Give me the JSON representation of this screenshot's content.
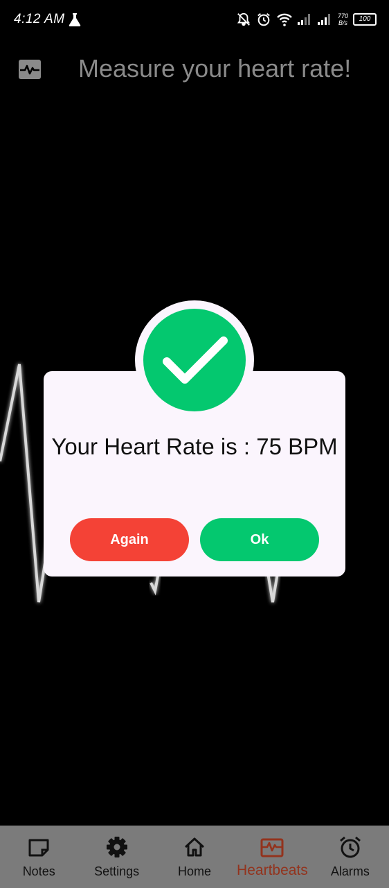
{
  "status_bar": {
    "time": "4:12 AM",
    "net_speed_value": "770",
    "net_speed_unit": "B/s",
    "battery": "100"
  },
  "header": {
    "title": "Measure your heart rate!",
    "icon": "heartbeat-monitor-icon"
  },
  "dialog": {
    "icon": "check-icon",
    "message": "Your Heart Rate is : 75 BPM",
    "again_label": "Again",
    "ok_label": "Ok"
  },
  "bottom_nav": {
    "items": [
      {
        "label": "Notes",
        "icon": "note-icon"
      },
      {
        "label": "Settings",
        "icon": "gear-icon"
      },
      {
        "label": "Home",
        "icon": "home-icon"
      },
      {
        "label": "Heartbeats",
        "icon": "heartbeat-icon",
        "active": true
      },
      {
        "label": "Alarms",
        "icon": "alarm-clock-icon"
      }
    ]
  },
  "colors": {
    "success": "#04c86f",
    "danger": "#f44236",
    "active_nav": "#93331d",
    "nav_background": "#7b7b7b",
    "dialog_background": "#fbf5fd"
  }
}
